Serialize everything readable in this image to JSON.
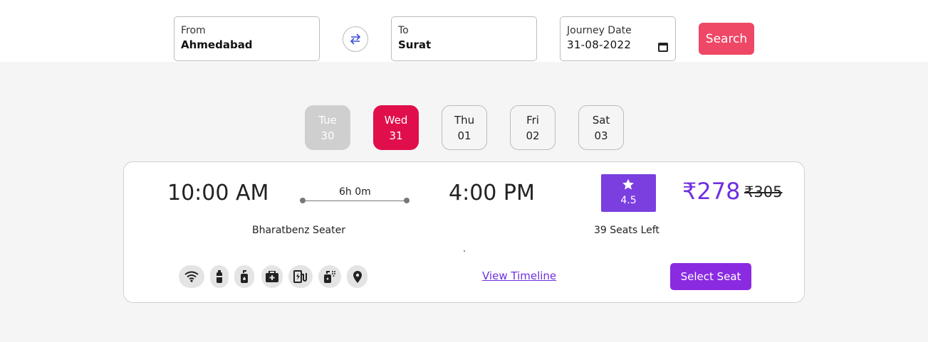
{
  "search": {
    "from_label": "From",
    "from_value": "Ahmedabad",
    "to_label": "To",
    "to_value": "Surat",
    "date_label": "Journey Date",
    "date_value": "31-08-2022",
    "search_label": "Search"
  },
  "days": [
    {
      "name": "Tue",
      "num": "30",
      "state": "past"
    },
    {
      "name": "Wed",
      "num": "31",
      "state": "active"
    },
    {
      "name": "Thu",
      "num": "01",
      "state": "normal"
    },
    {
      "name": "Fri",
      "num": "02",
      "state": "normal"
    },
    {
      "name": "Sat",
      "num": "03",
      "state": "normal"
    }
  ],
  "bus": {
    "departure": "10:00 AM",
    "duration": "6h 0m",
    "arrival": "4:00 PM",
    "rating": "4.5",
    "price": "₹278",
    "old_price": "₹305",
    "bus_type": "Bharatbenz Seater",
    "seats_left": "39 Seats Left",
    "timeline_label": "View Timeline",
    "select_label": "Select Seat",
    "amenities": [
      "wifi-icon",
      "water-bottle-icon",
      "sanitizer-icon",
      "first-aid-icon",
      "charging-point-icon",
      "hand-sanitizer-icon",
      "location-icon"
    ]
  },
  "colors": {
    "accent": "#e00f4c",
    "search": "#ef4766",
    "purple": "#8a2be2",
    "rating": "#7b3fe0"
  }
}
